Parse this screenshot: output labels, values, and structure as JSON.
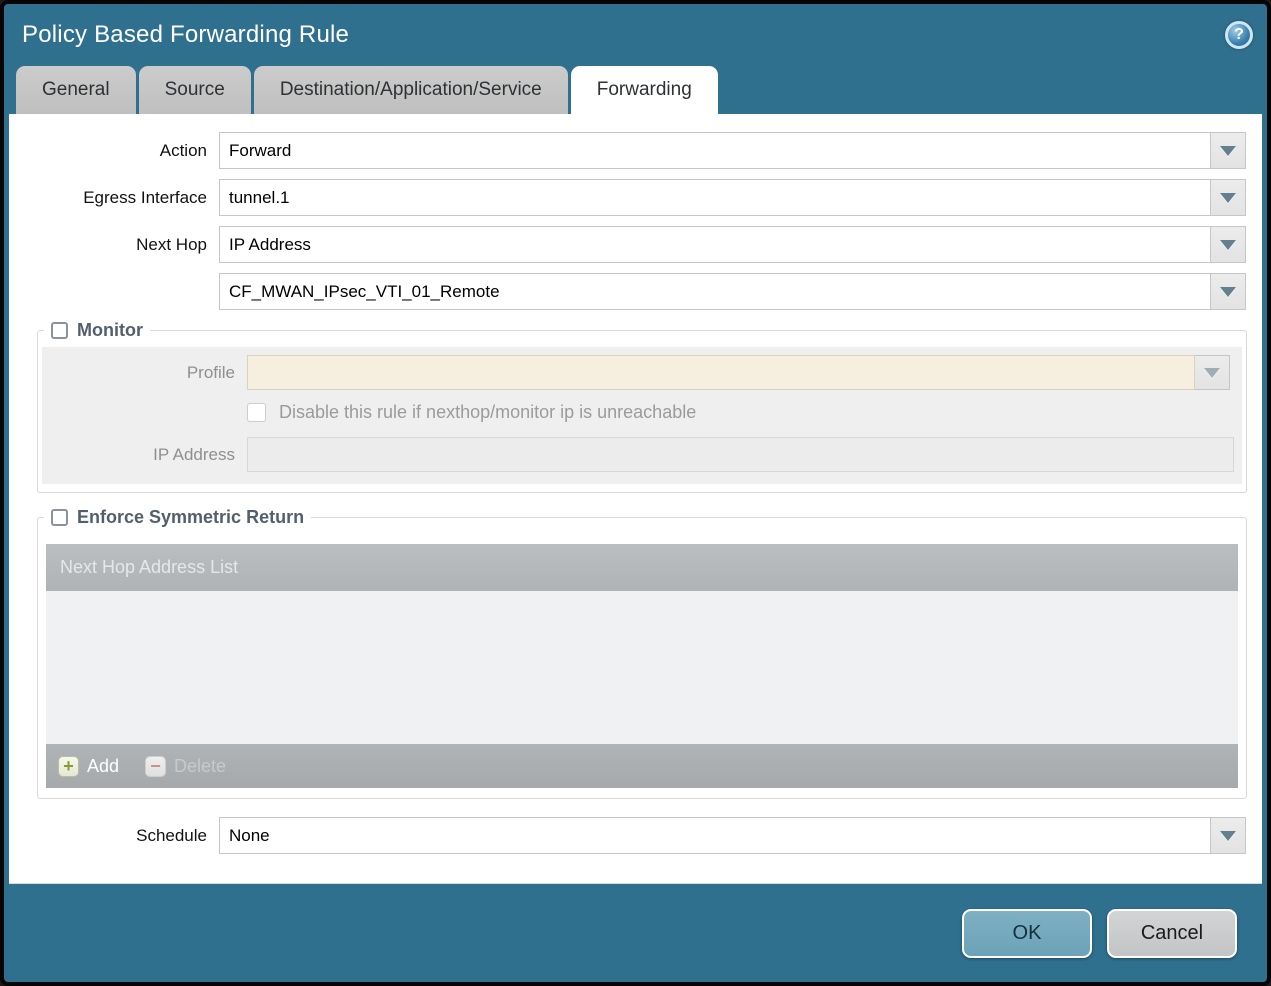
{
  "dialog": {
    "title": "Policy Based Forwarding Rule",
    "help_glyph": "?",
    "tabs": [
      {
        "label": "General",
        "active": false
      },
      {
        "label": "Source",
        "active": false
      },
      {
        "label": "Destination/Application/Service",
        "active": false
      },
      {
        "label": "Forwarding",
        "active": true
      }
    ]
  },
  "form": {
    "action": {
      "label": "Action",
      "value": "Forward"
    },
    "egress_interface": {
      "label": "Egress Interface",
      "value": "tunnel.1"
    },
    "next_hop": {
      "label": "Next Hop",
      "value": "IP Address"
    },
    "next_hop_address": {
      "value": "CF_MWAN_IPsec_VTI_01_Remote"
    },
    "schedule": {
      "label": "Schedule",
      "value": "None"
    }
  },
  "monitor": {
    "legend": "Monitor",
    "checked": false,
    "profile": {
      "label": "Profile",
      "value": ""
    },
    "disable_rule": {
      "label": "Disable this rule if nexthop/monitor ip is unreachable",
      "checked": false
    },
    "ip_address": {
      "label": "IP Address",
      "value": ""
    }
  },
  "symmetric_return": {
    "legend": "Enforce Symmetric Return",
    "checked": false,
    "table": {
      "header": "Next Hop Address List",
      "rows": []
    },
    "add_label": "Add",
    "delete_label": "Delete",
    "delete_enabled": false
  },
  "footer": {
    "ok_label": "OK",
    "cancel_label": "Cancel"
  },
  "colors": {
    "frame_teal": "#30708f",
    "tab_inactive": "#c6c6c6",
    "tab_active": "#ffffff",
    "profile_disabled_bg": "#f6efdf",
    "table_header_bg": "#b4b8ba",
    "ok_button_bg": "#74a8bc",
    "cancel_button_bg": "#c9cbcd",
    "add_plus_green": "#8a9a33",
    "delete_minus_red": "#cd8d8d"
  }
}
